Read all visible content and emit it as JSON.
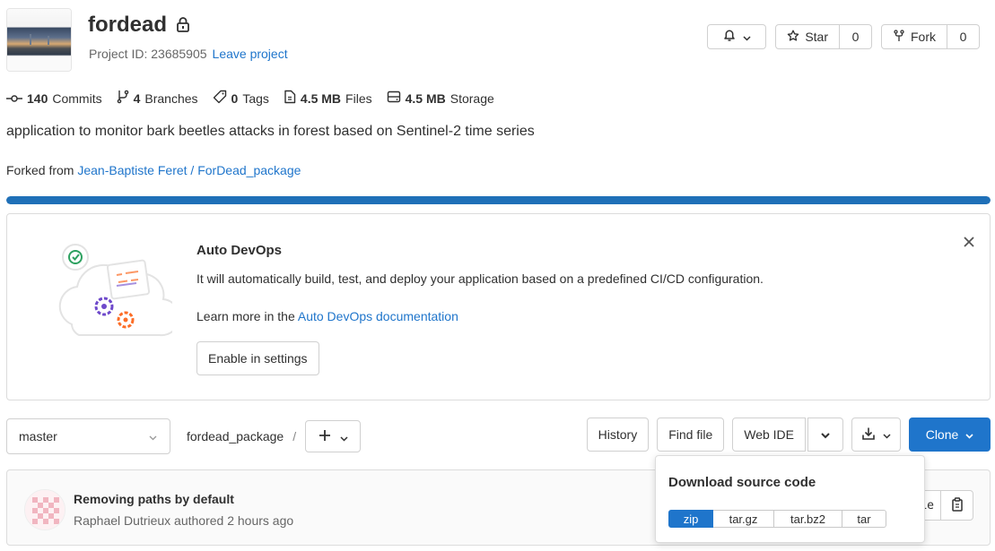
{
  "project": {
    "name": "fordead",
    "id_text": "Project ID: 23685905",
    "leave_link": "Leave project"
  },
  "header": {
    "star_label": "Star",
    "star_count": "0",
    "fork_label": "Fork",
    "fork_count": "0"
  },
  "stats": {
    "commits_count": "140",
    "commits_label": "Commits",
    "branches_count": "4",
    "branches_label": "Branches",
    "tags_count": "0",
    "tags_label": "Tags",
    "files_size": "4.5 MB",
    "files_label": "Files",
    "storage_size": "4.5 MB",
    "storage_label": "Storage"
  },
  "description": "application to monitor bark beetles attacks in forest based on Sentinel-2 time series",
  "forked": {
    "prefix": "Forked from",
    "source": "Jean-Baptiste Feret / ForDead_package"
  },
  "progress": {
    "fraction": 1.0,
    "color": "#1f70b8"
  },
  "devops": {
    "title": "Auto DevOps",
    "text": "It will automatically build, test, and deploy your application based on a predefined CI/CD configuration.",
    "learn_prefix": "Learn more in the",
    "learn_link": "Auto DevOps documentation",
    "button": "Enable in settings"
  },
  "tree": {
    "branch": "master",
    "path": "fordead_package",
    "separator": "/",
    "history": "History",
    "find_file": "Find file",
    "web_ide": "Web IDE",
    "clone": "Clone"
  },
  "commit": {
    "title": "Removing paths by default",
    "author_line": "Raphael Dutrieux authored 2 hours ago",
    "sha_fragment": ")c1e"
  },
  "download": {
    "title": "Download source code",
    "formats": [
      "zip",
      "tar.gz",
      "tar.bz2",
      "tar"
    ],
    "selected": "zip"
  },
  "colors": {
    "accent": "#1f75cb",
    "text": "#303030",
    "muted": "#666666"
  },
  "icons": [
    "lock-icon",
    "bell-icon",
    "chevron-down-icon",
    "star-icon",
    "fork-icon",
    "commit-icon",
    "branch-icon",
    "tag-icon",
    "file-icon",
    "storage-icon",
    "close-icon",
    "plus-icon",
    "download-icon",
    "copy-icon"
  ]
}
